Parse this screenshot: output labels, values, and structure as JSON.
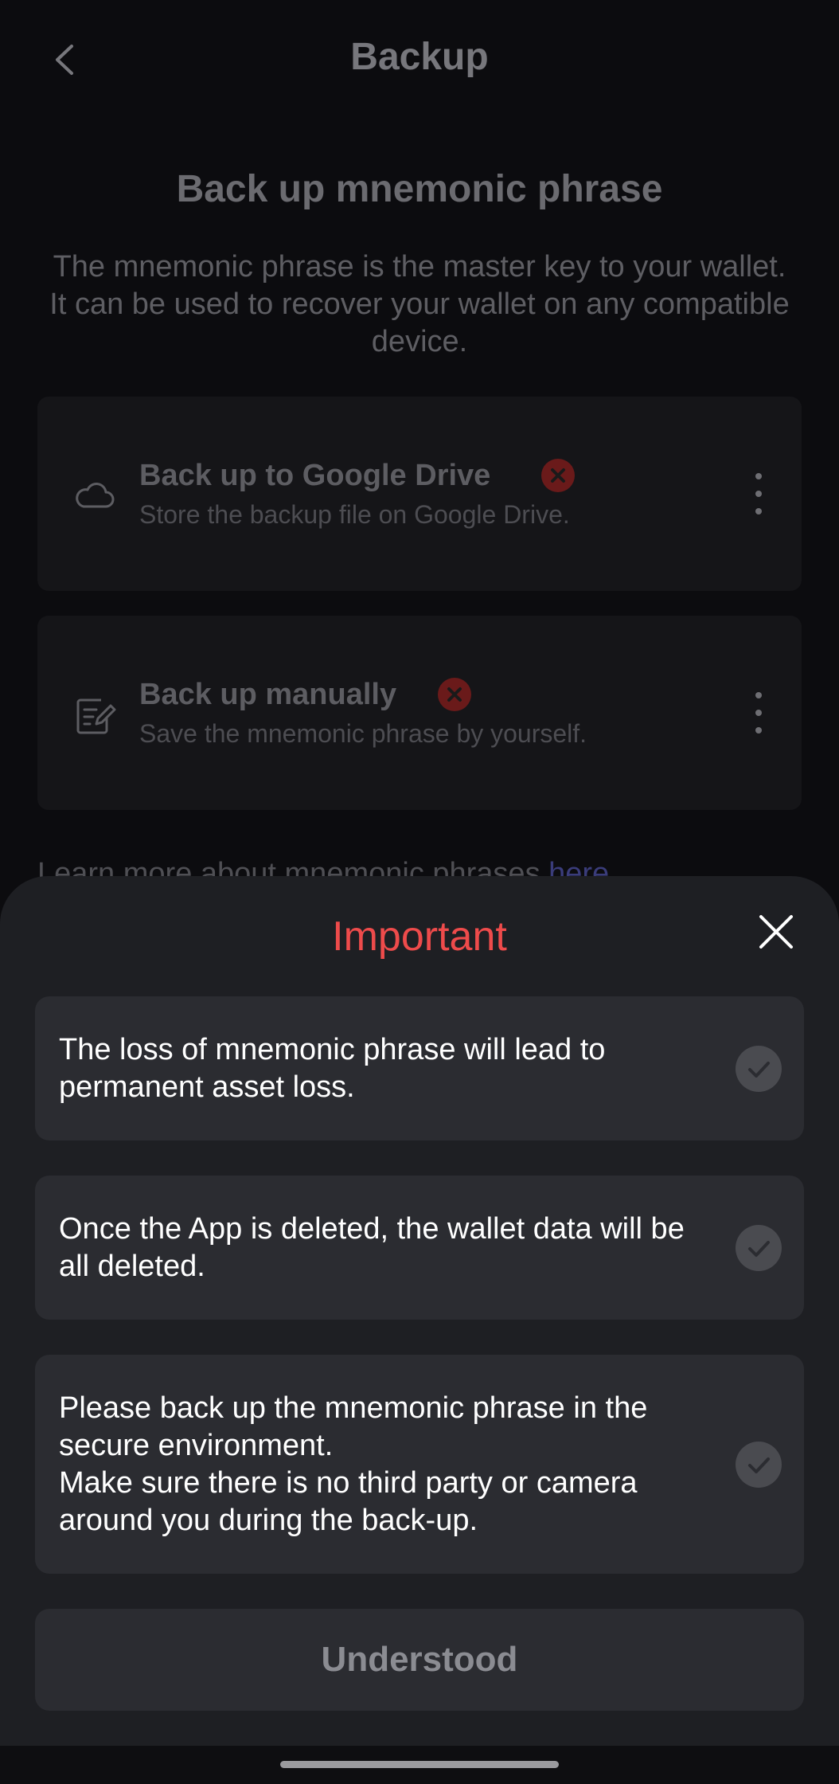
{
  "header": {
    "title": "Backup",
    "back_icon": "chevron-left-icon"
  },
  "intro": {
    "title": "Back up mnemonic phrase",
    "description": "The mnemonic phrase is the master key to your wallet. It can be used to recover your wallet on any compatible device."
  },
  "options": [
    {
      "title": "Back up to Google Drive",
      "subtitle": "Store the backup file on Google Drive.",
      "icon": "cloud-icon",
      "status_icon": "error-x-icon"
    },
    {
      "title": "Back up manually",
      "subtitle": "Save the mnemonic phrase by yourself.",
      "icon": "edit-note-icon",
      "status_icon": "error-x-icon"
    }
  ],
  "learn_more": {
    "text": "Learn more about mnemonic phrases ",
    "link": "here"
  },
  "sheet": {
    "title": "Important",
    "close_icon": "close-icon",
    "notices": [
      {
        "text": "The loss of mnemonic phrase will lead to permanent asset loss.",
        "checked": false
      },
      {
        "text": "Once the App is deleted, the wallet data will be all deleted.",
        "checked": false
      },
      {
        "text": "Please back up the mnemonic phrase in the secure environment.\nMake sure there is no third party or camera around you during the back-up.",
        "checked": false
      }
    ],
    "button_label": "Understood"
  },
  "colors": {
    "accent_red": "#ee4b4b",
    "link": "#3a3c7a",
    "sheet_bg": "#1e1f23",
    "card_bg": "#2b2c31"
  }
}
